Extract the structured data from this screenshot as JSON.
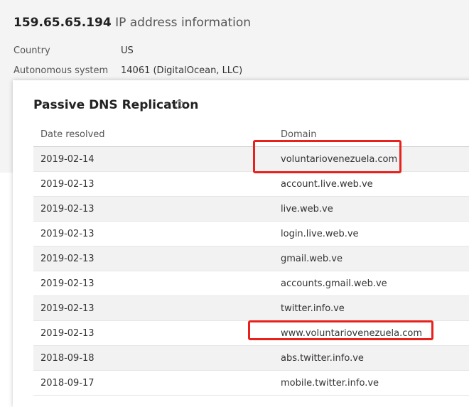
{
  "header": {
    "ip": "159.65.65.194",
    "title_suffix": "IP address information"
  },
  "meta": {
    "country_label": "Country",
    "country_value": "US",
    "as_label": "Autonomous system",
    "as_value": "14061 (DigitalOcean, LLC)"
  },
  "passive_dns": {
    "title": "Passive DNS Replication",
    "info_icon": "info-circle-icon",
    "columns": {
      "date": "Date resolved",
      "domain": "Domain"
    },
    "rows": [
      {
        "date": "2019-02-14",
        "domain": "voluntariovenezuela.com"
      },
      {
        "date": "2019-02-13",
        "domain": "account.live.web.ve"
      },
      {
        "date": "2019-02-13",
        "domain": "live.web.ve"
      },
      {
        "date": "2019-02-13",
        "domain": "login.live.web.ve"
      },
      {
        "date": "2019-02-13",
        "domain": "gmail.web.ve"
      },
      {
        "date": "2019-02-13",
        "domain": "accounts.gmail.web.ve"
      },
      {
        "date": "2019-02-13",
        "domain": "twitter.info.ve"
      },
      {
        "date": "2019-02-13",
        "domain": "www.voluntariovenezuela.com"
      },
      {
        "date": "2018-09-18",
        "domain": "abs.twitter.info.ve"
      },
      {
        "date": "2018-09-17",
        "domain": "mobile.twitter.info.ve"
      }
    ]
  },
  "colors": {
    "highlight": "#e8211d",
    "band_background": "#f4f4f4",
    "row_stripe": "#f2f2f2"
  }
}
